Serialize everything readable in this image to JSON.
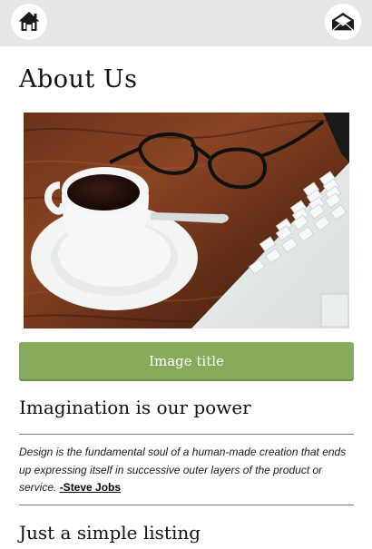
{
  "header": {
    "home_icon": "home-icon",
    "mail_icon": "envelope-icon"
  },
  "page": {
    "title": "About Us"
  },
  "hero": {
    "image": "coffee cup, glasses and laptop on wooden desk"
  },
  "buttons": {
    "image_title_label": "Image title"
  },
  "sections": {
    "first_title": "Imagination is our power",
    "quote_text": "Design is the fundamental soul of a human-made creation that ends up expressing itself in successive outer layers of the product or service.",
    "quote_author": "-Steve Jobs",
    "second_title": "Just a simple listing"
  },
  "colors": {
    "topbar_bg": "#e6e6e6",
    "button_green": "#86ab5d",
    "divider": "#777777"
  }
}
